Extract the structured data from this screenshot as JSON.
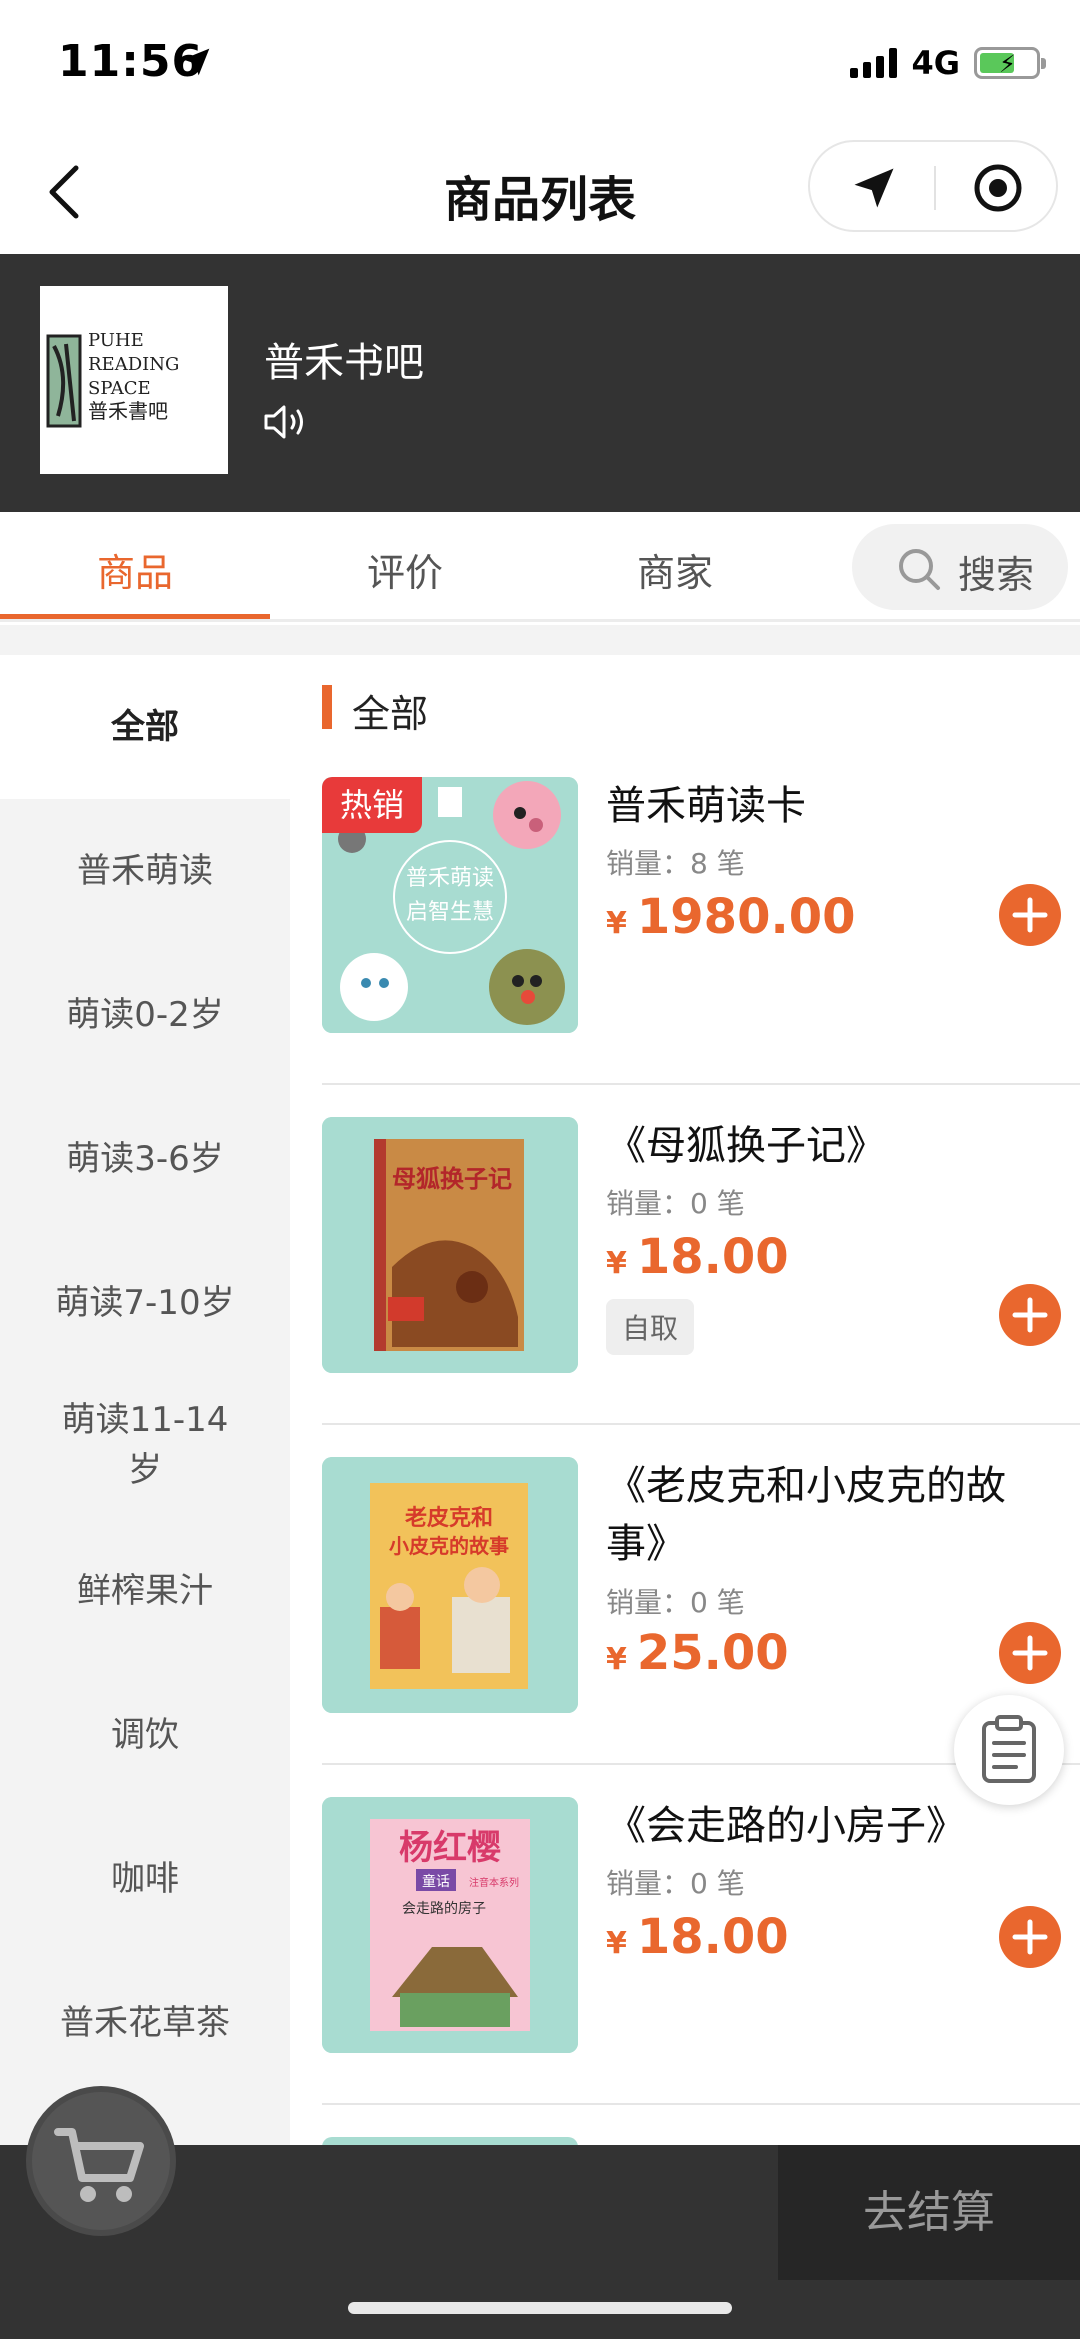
{
  "status": {
    "time": "11:56",
    "network": "4G"
  },
  "nav": {
    "title": "商品列表"
  },
  "shop": {
    "name": "普禾书吧",
    "logo_lines": [
      "PUHE",
      "READING",
      "SPACE",
      "普禾書吧"
    ]
  },
  "tabs": [
    {
      "label": "商品",
      "active": true
    },
    {
      "label": "评价",
      "active": false
    },
    {
      "label": "商家",
      "active": false
    }
  ],
  "search": {
    "label": "搜索"
  },
  "categories": [
    {
      "label": "全部",
      "active": true
    },
    {
      "label": "普禾萌读"
    },
    {
      "label": "萌读0-2岁"
    },
    {
      "label": "萌读3-6岁"
    },
    {
      "label": "萌读7-10岁"
    },
    {
      "label": "萌读11-14\n岁"
    },
    {
      "label": "鲜榨果汁"
    },
    {
      "label": "调饮"
    },
    {
      "label": "咖啡"
    },
    {
      "label": "普禾花草茶"
    }
  ],
  "section": {
    "title": "全部"
  },
  "products": [
    {
      "name": "普禾萌读卡",
      "sales": "销量：8 笔",
      "currency": "¥",
      "price": "1980.00",
      "badge": "热销",
      "cover_text": [
        "普禾萌读",
        "启智生慧"
      ]
    },
    {
      "name": "《母狐换子记》",
      "sales": "销量：0 笔",
      "currency": "¥",
      "price": "18.00",
      "tag": "自取",
      "cover_text": [
        "母狐换子记"
      ]
    },
    {
      "name": "《老皮克和小皮克的故事》",
      "sales": "销量：0 笔",
      "currency": "¥",
      "price": "25.00",
      "cover_text": [
        "老皮克和",
        "小皮克的故事"
      ]
    },
    {
      "name": "《会走路的小房子》",
      "sales": "销量：0 笔",
      "currency": "¥",
      "price": "18.00",
      "cover_text": [
        "杨红樱",
        "童话",
        "注音本系列",
        "会走路的房子"
      ]
    }
  ],
  "bottom": {
    "checkout_label": "去结算"
  },
  "colors": {
    "accent": "#e9672e",
    "header_bg": "#333333",
    "hot": "#e83a3a"
  }
}
